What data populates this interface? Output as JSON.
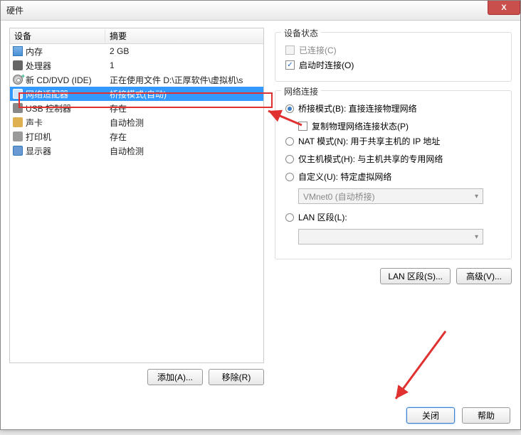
{
  "window": {
    "title": "硬件",
    "close_x": "X"
  },
  "table": {
    "col_device": "设备",
    "col_summary": "摘要",
    "rows": [
      {
        "icon": "memory",
        "name": "内存",
        "summary": "2 GB"
      },
      {
        "icon": "cpu",
        "name": "处理器",
        "summary": "1"
      },
      {
        "icon": "cd-add",
        "name": "新 CD/DVD (IDE)",
        "summary": "正在使用文件 D:\\正厚软件\\虚拟机\\s"
      },
      {
        "icon": "network",
        "name": "网络适配器",
        "summary": "桥接模式(自动)",
        "selected": true
      },
      {
        "icon": "usb",
        "name": "USB 控制器",
        "summary": "存在"
      },
      {
        "icon": "sound",
        "name": "声卡",
        "summary": "自动检测"
      },
      {
        "icon": "printer",
        "name": "打印机",
        "summary": "存在"
      },
      {
        "icon": "display",
        "name": "显示器",
        "summary": "自动检测"
      }
    ]
  },
  "left_buttons": {
    "add": "添加(A)...",
    "remove": "移除(R)"
  },
  "device_status": {
    "title": "设备状态",
    "connected": "已连接(C)",
    "connect_on_boot": "启动时连接(O)"
  },
  "network": {
    "title": "网络连接",
    "bridged": "桥接模式(B): 直接连接物理网络",
    "replicate": "复制物理网络连接状态(P)",
    "nat": "NAT 模式(N): 用于共享主机的 IP 地址",
    "hostonly": "仅主机模式(H): 与主机共享的专用网络",
    "custom": "自定义(U): 特定虚拟网络",
    "custom_value": "VMnet0 (自动桥接)",
    "lan_segment": "LAN 区段(L):",
    "lan_value": ""
  },
  "right_buttons": {
    "lan_segments": "LAN 区段(S)...",
    "advanced": "高级(V)..."
  },
  "footer": {
    "close": "关闭",
    "help": "帮助"
  }
}
